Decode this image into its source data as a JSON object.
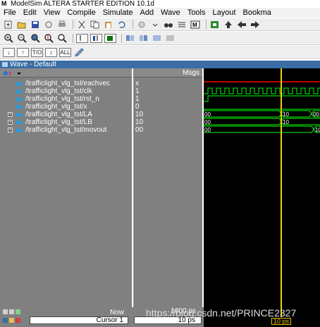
{
  "window": {
    "title": "ModelSim ALTERA STARTER EDITION 10.1d",
    "logo": "M"
  },
  "menubar": [
    "File",
    "Edit",
    "View",
    "Compile",
    "Simulate",
    "Add",
    "Wave",
    "Tools",
    "Layout",
    "Bookma"
  ],
  "toolbar3": {
    "buttons": [
      "↓",
      "↑",
      "T/O",
      "↕",
      "ALL"
    ]
  },
  "wave_window": {
    "title": "Wave - Default",
    "msgs_header": "Msgs",
    "signals": [
      {
        "name": "/trafficlight_vlg_tst/eachvec",
        "value": "x",
        "expandable": false
      },
      {
        "name": "/trafficlight_vlg_tst/clk",
        "value": "1",
        "expandable": false
      },
      {
        "name": "/trafficlight_vlg_tst/rst_n",
        "value": "1",
        "expandable": false
      },
      {
        "name": "/trafficlight_vlg_tst/x",
        "value": "0",
        "expandable": false
      },
      {
        "name": "/trafficlight_vlg_tst/LA",
        "value": "10",
        "expandable": true
      },
      {
        "name": "/trafficlight_vlg_tst/LB",
        "value": "10",
        "expandable": true
      },
      {
        "name": "/trafficlight_vlg_tst/movout",
        "value": "00",
        "expandable": true
      }
    ],
    "bus_labels": {
      "la_start": "00",
      "la_mid": "10",
      "la_end": "00",
      "lb_start": "00",
      "lb_mid": "10",
      "mov_start": "00",
      "mov_end": "10"
    },
    "footer": {
      "now_label": "Now",
      "now_value": "1000 ps",
      "cursor_label": "Cursor 1",
      "cursor_value": "10 ps",
      "cursor_tag": "10 ps"
    },
    "watermark": "https://blog.csdn.net/PRINCE2327"
  },
  "colors": {
    "wave_green": "#00ff00",
    "cursor_yellow": "#f0d000",
    "x_red": "#ff0000",
    "panel_gray": "#808080",
    "header_blue": "#3a6ea5"
  }
}
